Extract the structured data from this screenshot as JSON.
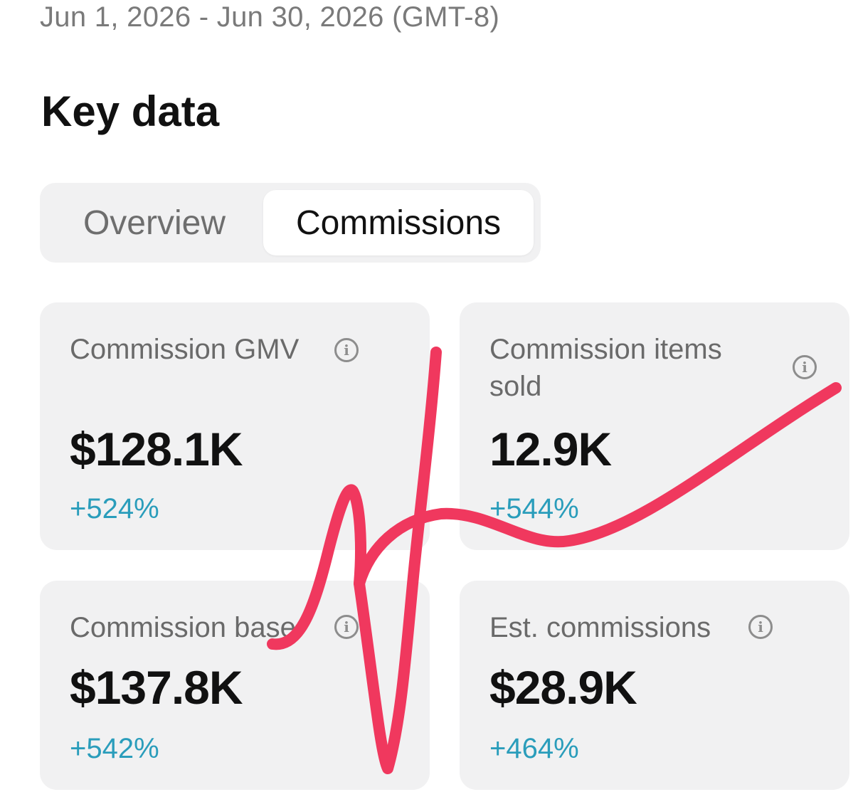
{
  "header": {
    "date_range": "Jun 1, 2026 - Jun 30, 2026 (GMT-8)",
    "title": "Key data"
  },
  "tabs": [
    {
      "label": "Overview",
      "selected": false
    },
    {
      "label": "Commissions",
      "selected": true
    }
  ],
  "cards": [
    {
      "label": "Commission GMV",
      "value": "$128.1K",
      "change": "+524%"
    },
    {
      "label": "Commission items sold",
      "value": "12.9K",
      "change": "+544%"
    },
    {
      "label": "Commission base",
      "value": "$137.8K",
      "change": "+542%"
    },
    {
      "label": "Est. commissions",
      "value": "$28.9K",
      "change": "+464%"
    }
  ],
  "icons": {
    "info": "info-circle-icon"
  },
  "colors": {
    "change_positive": "#2a9dbb",
    "scribble": "#f0385e",
    "card_background": "#f1f1f2"
  }
}
